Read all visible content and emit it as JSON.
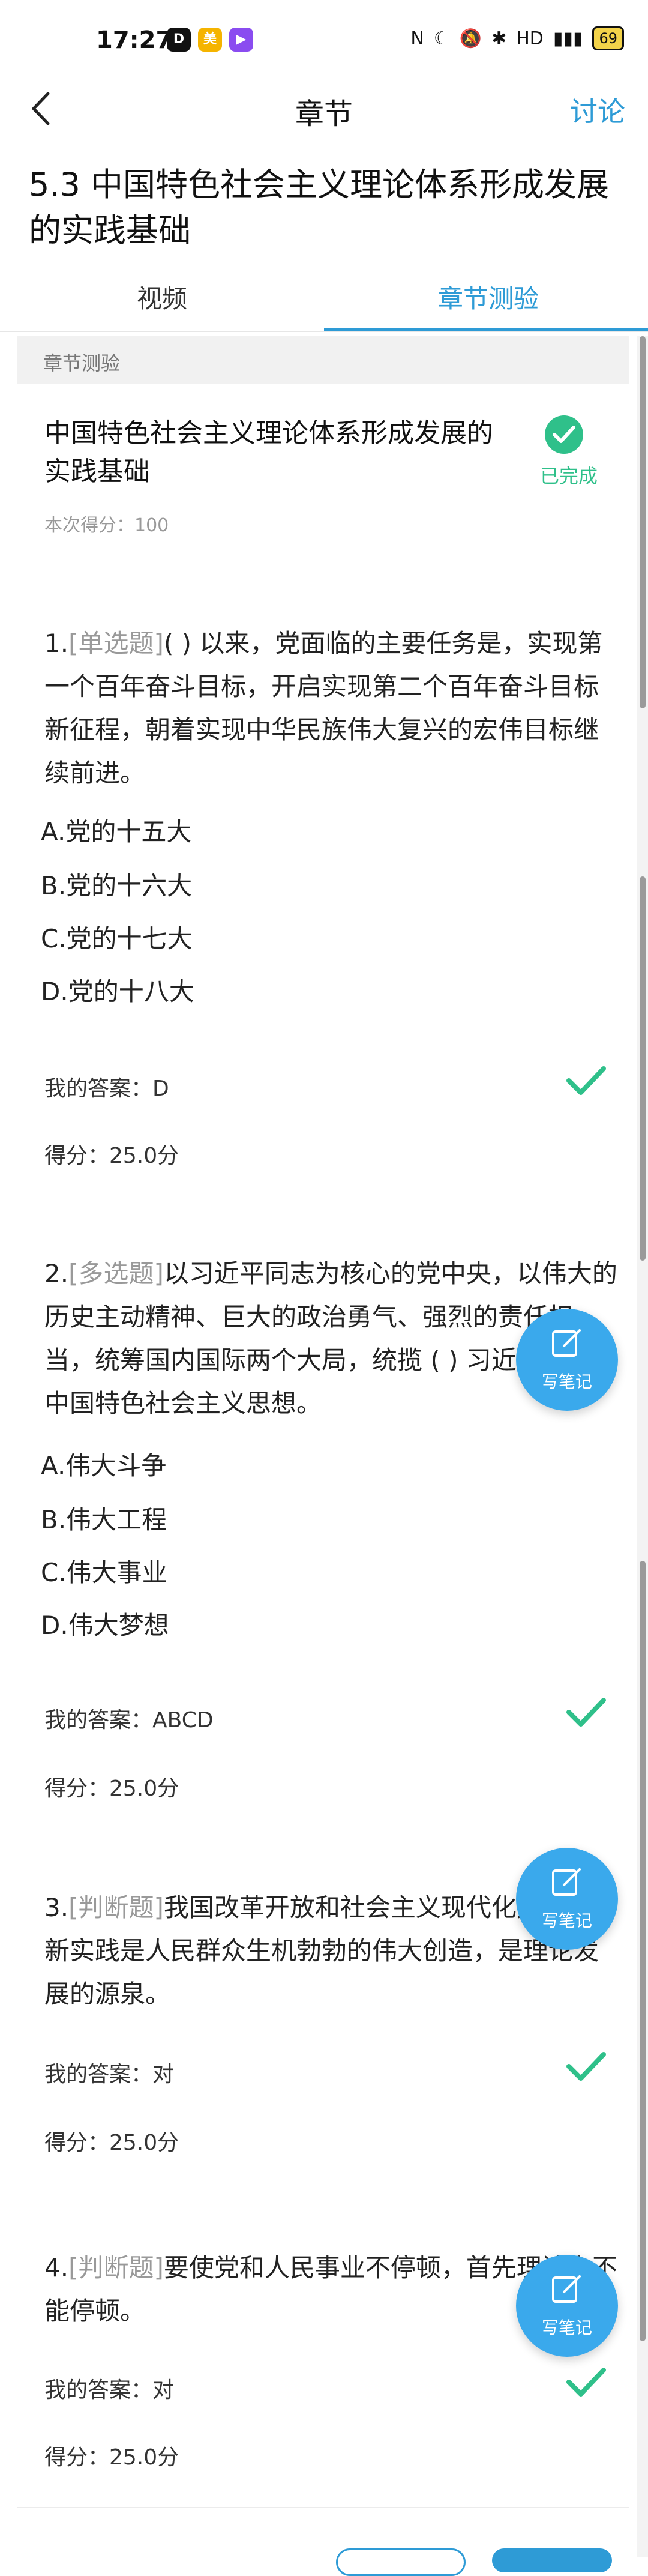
{
  "status_bar": {
    "time": "17:27",
    "battery": "69"
  },
  "nav": {
    "title": "章节",
    "discuss": "讨论"
  },
  "chapter_title": "5.3 中国特色社会主义理论体系形成发展的实践基础",
  "tabs": [
    {
      "label": "视频"
    },
    {
      "label": "章节测验"
    }
  ],
  "section_label": "章节测验",
  "summary": {
    "title": "中国特色社会主义理论体系形成发展的实践基础",
    "status": "已完成",
    "score": "本次得分：100"
  },
  "questions": [
    {
      "number": "1.",
      "type": "[单选题]",
      "text": "( ) 以来，党面临的主要任务是，实现第一个百年奋斗目标，开启实现第二个百年奋斗目标新征程，朝着实现中华民族伟大复兴的宏伟目标继续前进。",
      "options": [
        "A.党的十五大",
        "B.党的十六大",
        "C.党的十七大",
        "D.党的十八大"
      ],
      "my_answer": "我的答案：D",
      "score": "得分：25.0分"
    },
    {
      "number": "2.",
      "type": "[多选题]",
      "text": "以习近平同志为核心的党中央，以伟大的历史主动精神、巨大的政治勇气、强烈的责任担当，统筹国内国际两个大局，统揽 ( ) 习近平新时代中国特色社会主义思想。",
      "options": [
        "A.伟大斗争",
        "B.伟大工程",
        "C.伟大事业",
        "D.伟大梦想"
      ],
      "my_answer": "我的答案：ABCD",
      "score": "得分：25.0分"
    },
    {
      "number": "3.",
      "type": "[判断题]",
      "text": "我国改革开放和社会主义现代化建设的崭新实践是人民群众生机勃勃的伟大创造，是理论发展的源泉。",
      "options": [],
      "my_answer": "我的答案：对",
      "score": "得分：25.0分"
    },
    {
      "number": "4.",
      "type": "[判断题]",
      "text": "要使党和人民事业不停顿，首先理论上不能停顿。",
      "options": [],
      "my_answer": "我的答案：对",
      "score": "得分：25.0分"
    }
  ],
  "note_button": "写笔记",
  "colors": {
    "accent": "#2e9bd6",
    "success": "#2fc08a",
    "fab": "#3aa9ec"
  }
}
